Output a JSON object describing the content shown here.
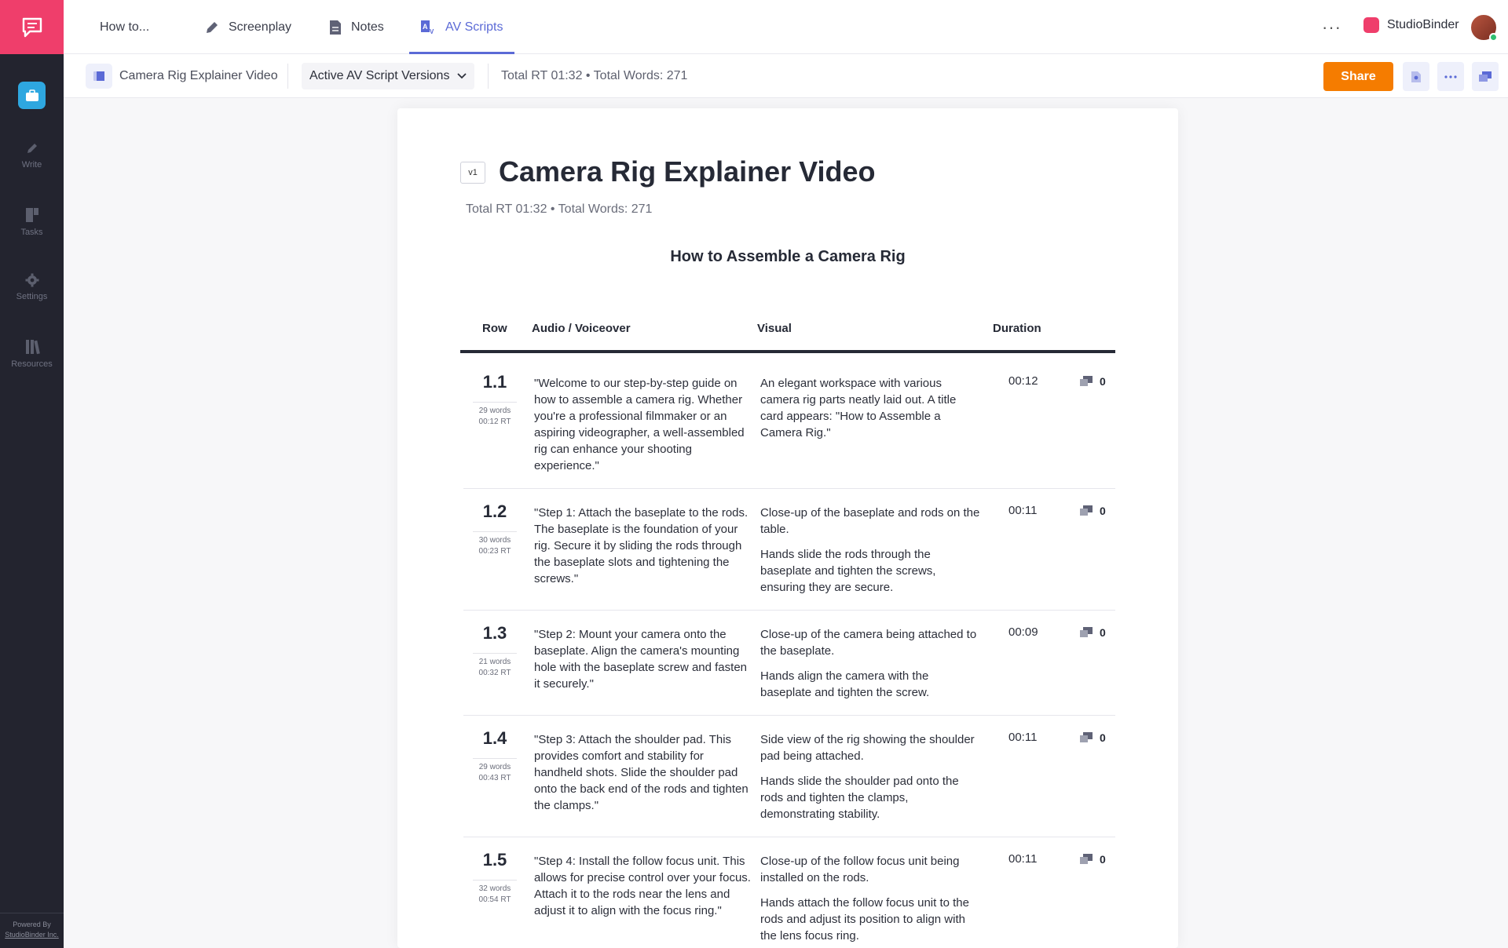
{
  "rail": {
    "items": [
      {
        "label": "Write",
        "icon": "pencil-icon"
      },
      {
        "label": "Tasks",
        "icon": "tasks-icon"
      },
      {
        "label": "Settings",
        "icon": "gear-icon"
      },
      {
        "label": "Resources",
        "icon": "library-icon"
      }
    ],
    "footer_line1": "Powered By",
    "footer_line2": "StudioBinder Inc."
  },
  "topnav": {
    "tabs": [
      {
        "label": "How to...",
        "icon": ""
      },
      {
        "label": "Screenplay",
        "icon": "pen-icon"
      },
      {
        "label": "Notes",
        "icon": "document-icon"
      },
      {
        "label": "AV Scripts",
        "icon": "av-script-icon"
      }
    ],
    "active_tab": "AV Scripts",
    "brand": "StudioBinder",
    "more": "···"
  },
  "toolbar": {
    "project_name": "Camera Rig Explainer Video",
    "versions_label": "Active AV Script Versions",
    "totals": "Total RT 01:32 • Total Words: 271",
    "share_label": "Share"
  },
  "doc": {
    "version_badge": "v1",
    "title": "Camera Rig Explainer Video",
    "subtitle": "Total RT 01:32 • Total Words: 271",
    "section_title": "How to Assemble a Camera Rig",
    "columns": {
      "row": "Row",
      "audio": "Audio / Voiceover",
      "visual": "Visual",
      "duration": "Duration"
    },
    "rows": [
      {
        "num": "1.1",
        "words": "29 words",
        "rt": "00:12 RT",
        "audio": "\"Welcome to our step-by-step guide on how to assemble a camera rig. Whether you're a professional filmmaker or an aspiring videographer, a well-assembled rig can enhance your shooting experience.\"",
        "visual": [
          "An elegant workspace with various camera rig parts neatly laid out. A title card appears: \"How to Assemble a Camera Rig.\""
        ],
        "duration": "00:12",
        "comments": "0"
      },
      {
        "num": "1.2",
        "words": "30 words",
        "rt": "00:23 RT",
        "audio": "\"Step 1: Attach the baseplate to the rods. The baseplate is the foundation of your rig. Secure it by sliding the rods through the baseplate slots and tightening the screws.\"",
        "visual": [
          "Close-up of the baseplate and rods on the table.",
          "Hands slide the rods through the baseplate and tighten the screws, ensuring they are secure."
        ],
        "duration": "00:11",
        "comments": "0"
      },
      {
        "num": "1.3",
        "words": "21 words",
        "rt": "00:32 RT",
        "audio": "\"Step 2: Mount your camera onto the baseplate. Align the camera's mounting hole with the baseplate screw and fasten it securely.\"",
        "visual": [
          "Close-up of the camera being attached to the baseplate.",
          "Hands align the camera with the baseplate and tighten the screw."
        ],
        "duration": "00:09",
        "comments": "0"
      },
      {
        "num": "1.4",
        "words": "29 words",
        "rt": "00:43 RT",
        "audio": "\"Step 3: Attach the shoulder pad. This provides comfort and stability for handheld shots. Slide the shoulder pad onto the back end of the rods and tighten the clamps.\"",
        "visual": [
          "Side view of the rig showing the shoulder pad being attached.",
          "Hands slide the shoulder pad onto the rods and tighten the clamps, demonstrating stability."
        ],
        "duration": "00:11",
        "comments": "0"
      },
      {
        "num": "1.5",
        "words": "32 words",
        "rt": "00:54 RT",
        "audio": "\"Step 4: Install the follow focus unit. This allows for precise control over your focus. Attach it to the rods near the lens and adjust it to align with the focus ring.\"",
        "visual": [
          "Close-up of the follow focus unit being installed on the rods.",
          "Hands attach the follow focus unit to the rods and adjust its position to align with the lens focus ring."
        ],
        "duration": "00:11",
        "comments": "0"
      }
    ]
  }
}
